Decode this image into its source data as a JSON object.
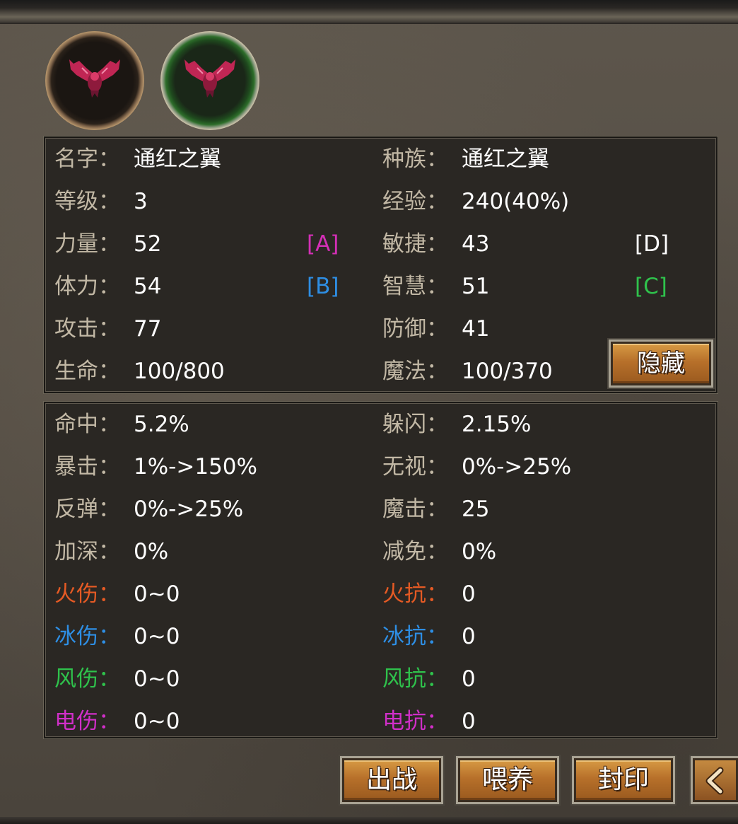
{
  "pet": {
    "name_label": "名字：",
    "name": "通红之翼",
    "race_label": "种族：",
    "race": "通红之翼",
    "level_label": "等级：",
    "level": "3",
    "exp_label": "经验：",
    "exp": "240(40%)",
    "str_label": "力量：",
    "str": "52",
    "str_grade": "[A]",
    "agi_label": "敏捷：",
    "agi": "43",
    "agi_grade": "[D]",
    "sta_label": "体力：",
    "sta": "54",
    "sta_grade": "[B]",
    "int_label": "智慧：",
    "int": "51",
    "int_grade": "[C]",
    "atk_label": "攻击：",
    "atk": "77",
    "def_label": "防御：",
    "def": "41",
    "hp_label": "生命：",
    "hp": "100/800",
    "mp_label": "魔法：",
    "mp": "100/370",
    "hide_button": "隐藏"
  },
  "combat": {
    "hit_label": "命中：",
    "hit": "5.2%",
    "dodge_label": "躲闪：",
    "dodge": "2.15%",
    "crit_label": "暴击：",
    "crit": "1%->150%",
    "ignore_label": "无视：",
    "ignore": "0%->25%",
    "reflect_label": "反弹：",
    "reflect": "0%->25%",
    "magic_atk_label": "魔击：",
    "magic_atk": "25",
    "deepen_label": "加深：",
    "deepen": "0%",
    "reduce_label": "减免：",
    "reduce": "0%",
    "fire_dmg_label": "火伤：",
    "fire_dmg": "0~0",
    "fire_res_label": "火抗：",
    "fire_res": "0",
    "ice_dmg_label": "冰伤：",
    "ice_dmg": "0~0",
    "ice_res_label": "冰抗：",
    "ice_res": "0",
    "wind_dmg_label": "风伤：",
    "wind_dmg": "0~0",
    "wind_res_label": "风抗：",
    "wind_res": "0",
    "elec_dmg_label": "电伤：",
    "elec_dmg": "0~0",
    "elec_res_label": "电抗：",
    "elec_res": "0"
  },
  "actions": {
    "deploy": "出战",
    "feed": "喂养",
    "seal": "封印"
  },
  "colors": {
    "grade_a": "#d42fb6",
    "grade_b": "#2e8ee3",
    "grade_c": "#2fc24c",
    "grade_d": "#ffffff",
    "fire": "#e55a24",
    "ice": "#2e8ee3",
    "wind": "#2fc24c",
    "electric": "#d02fc8"
  },
  "icons": {
    "pet_avatar": "crimson-wing-bat-icon",
    "back": "chevron-left-icon"
  }
}
